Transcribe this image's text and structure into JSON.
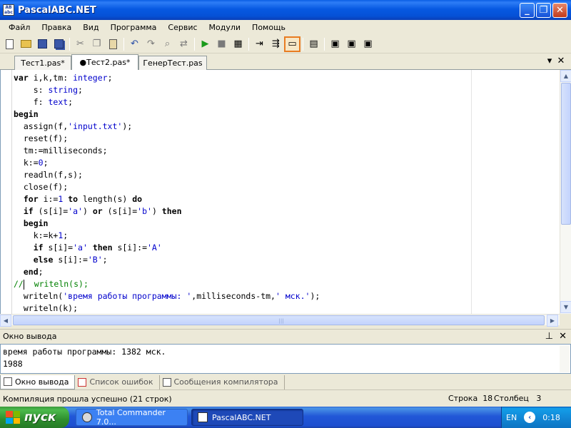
{
  "window": {
    "title": "PascalABC.NET",
    "app_icon_text": "AB\nabc",
    "minimize": "_",
    "maximize": "❐",
    "close": "✕"
  },
  "menu": [
    "Файл",
    "Правка",
    "Вид",
    "Программа",
    "Сервис",
    "Модули",
    "Помощь"
  ],
  "toolbar": {
    "icons": [
      "new-file-icon",
      "open-folder-icon",
      "save-icon",
      "save-all-icon",
      "cut-icon",
      "copy-icon",
      "paste-icon",
      "undo-icon",
      "redo-icon",
      "find-icon",
      "replace-icon",
      "run-icon",
      "stop-icon",
      "compile-icon",
      "step-icon",
      "debug-icon",
      "output-window-icon",
      "form-icon",
      "module-icon",
      "module2-icon",
      "module3-icon"
    ]
  },
  "tabs": [
    {
      "label": "Тест1.pas*",
      "active": false
    },
    {
      "label": "●Тест2.pas*",
      "active": true
    },
    {
      "label": "ГенерТест.pas",
      "active": false
    }
  ],
  "tab_controls": {
    "dropdown": "▾",
    "close": "✕"
  },
  "editor": {
    "lines": [
      "var i,k,tm: integer;",
      "    s: string;",
      "    f: text;",
      "begin",
      "  assign(f,'input.txt');",
      "  reset(f);",
      "  tm:=milliseconds;",
      "  k:=0;",
      "  readln(f,s);",
      "  close(f);",
      "  for i:=1 to length(s) do",
      "  if (s[i]='a') or (s[i]='b') then",
      "  begin",
      "    k:=k+1;",
      "    if s[i]='a' then s[i]:='A'",
      "    else s[i]:='B';",
      "  end;",
      "//  writeln(s);",
      "  writeln('время работы программы: ',milliseconds-tm,' мск.');",
      "  writeln(k);"
    ]
  },
  "output_panel": {
    "title": "Окно вывода",
    "pin": "⊥",
    "close": "✕",
    "lines": [
      "время работы программы: 1382 мск.",
      "1988"
    ]
  },
  "bottom_tabs": [
    "Окно вывода",
    "Список ошибок",
    "Сообщения компилятора"
  ],
  "status": {
    "message": "Компиляция прошла успешно (21 строк)",
    "row_label": "Строка",
    "row": "18",
    "col_label": "Столбец",
    "col": "3"
  },
  "taskbar": {
    "start_label": "пуск",
    "tasks": [
      "Total Commander 7.0...",
      "PascalABC.NET"
    ],
    "language": "EN",
    "clock": "0:18"
  },
  "colors": {
    "title_bar": "#0759e2",
    "keyword": "#000000",
    "type_string_number": "#0000cc",
    "comment": "#008000",
    "active_toolbar_border": "#e87c22"
  }
}
